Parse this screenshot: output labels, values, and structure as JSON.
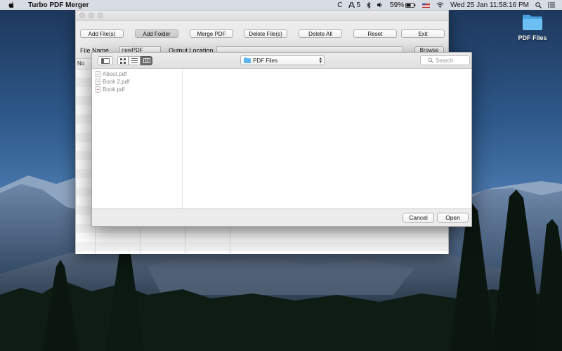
{
  "menubar": {
    "app_name": "Turbo PDF Merger",
    "status_items": [
      "C",
      "5",
      "59%"
    ],
    "datetime": "Wed 25 Jan  11:58:16 PM"
  },
  "desktop": {
    "folder_label": "PDF Files"
  },
  "app_window": {
    "toolbar": {
      "add_files": "Add File(s)",
      "add_folder": "Add Folder",
      "merge_pdf": "Merge PDF",
      "delete_files": "Delete File(s)",
      "delete_all": "Delete All",
      "reset": "Reset",
      "exit": "Exit"
    },
    "file_name_label": "File Name",
    "file_name_value": "newPDF",
    "output_location_label": "Output Location",
    "output_location_value": "",
    "browse_label": "Browse",
    "table_header_no": "No"
  },
  "dialog": {
    "location": "PDF Files",
    "search_placeholder": "Search",
    "files": [
      "About.pdf",
      "Book 2.pdf",
      "Book.pdf"
    ],
    "cancel_label": "Cancel",
    "open_label": "Open",
    "selected_view": "columns"
  },
  "colors": {
    "folder_blue": "#5fb6ee",
    "selected_segment": "#6a6a6a"
  }
}
